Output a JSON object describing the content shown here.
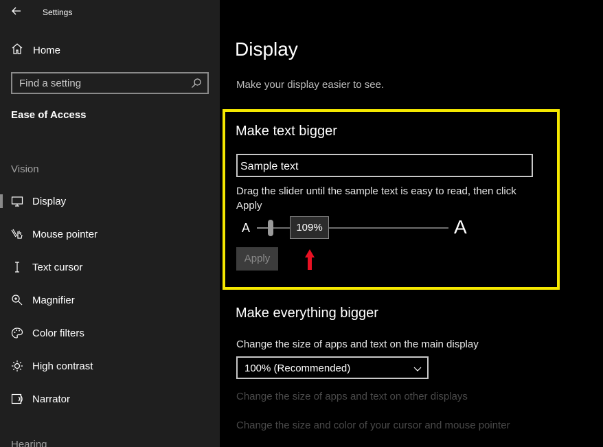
{
  "window": {
    "title": "Settings"
  },
  "sidebar": {
    "home_label": "Home",
    "search_placeholder": "Find a setting",
    "section": "Ease of Access",
    "group_vision": "Vision",
    "items": [
      {
        "label": "Display",
        "icon": "display-icon",
        "active": true
      },
      {
        "label": "Mouse pointer",
        "icon": "mouse-pointer-icon"
      },
      {
        "label": "Text cursor",
        "icon": "text-cursor-icon"
      },
      {
        "label": "Magnifier",
        "icon": "magnifier-icon"
      },
      {
        "label": "Color filters",
        "icon": "color-filters-icon"
      },
      {
        "label": "High contrast",
        "icon": "high-contrast-icon"
      },
      {
        "label": "Narrator",
        "icon": "narrator-icon"
      }
    ],
    "group_hearing": "Hearing"
  },
  "main": {
    "title": "Display",
    "subtitle": "Make your display easier to see.",
    "text_bigger": {
      "title": "Make text bigger",
      "sample": "Sample text",
      "instructions": "Drag the slider until the sample text is easy to read, then click Apply",
      "small_a": "A",
      "big_a": "A",
      "value": "109%",
      "value_percent": 109,
      "min_percent": 100,
      "max_percent": 225,
      "apply_label": "Apply",
      "highlight_color": "#f5e800",
      "arrow_color": "#e81123"
    },
    "everything_bigger": {
      "title": "Make everything bigger",
      "main_display_label": "Change the size of apps and text on the main display",
      "scale_selected": "100% (Recommended)",
      "other_displays_link": "Change the size of apps and text on other displays",
      "cursor_link": "Change the size and color of your cursor and mouse pointer"
    }
  }
}
